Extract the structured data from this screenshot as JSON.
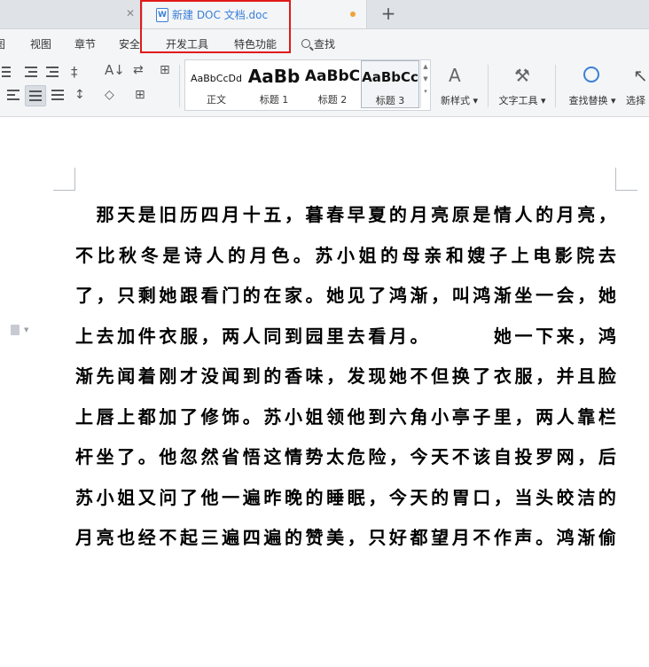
{
  "tabs": {
    "active_title": "新建 DOC 文档.doc",
    "new_tab_symbol": "+"
  },
  "menu": {
    "items": [
      "视图",
      "章节",
      "安全",
      "开发工具",
      "特色功能"
    ],
    "search_label": "查找"
  },
  "ribbon": {
    "styles": [
      {
        "preview": "AaBbCcDd",
        "label": "正文"
      },
      {
        "preview": "AaBb",
        "label": "标题 1"
      },
      {
        "preview": "AaBbC",
        "label": "标题 2"
      },
      {
        "preview": "AaBbCc",
        "label": "标题 3"
      }
    ],
    "new_style_label": "新样式",
    "text_tools_label": "文字工具",
    "find_replace_label": "查找替换",
    "select_label": "选择"
  },
  "document": {
    "lines": [
      "　那天是旧历四月十五，暮春早夏的月亮原是情人的月亮，",
      "不比秋冬是诗人的月色。苏小姐的母亲和嫂子上电影院去",
      "了，只剩她跟看门的在家。她见了鸿渐，叫鸿渐坐一会，她",
      "上去加件衣服，两人同到园里去看月。　　　她一下来，鸿",
      "渐先闻着刚才没闻到的香味，发现她不但换了衣服，并且脸",
      "上唇上都加了修饰。苏小姐领他到六角小亭子里，两人靠栏",
      "杆坐了。他忽然省悟这情势太危险，今天不该自投罗网，后",
      "苏小姐又问了他一遍昨晚的睡眠，今天的胃口，当头皎洁的",
      "月亮也经不起三遍四遍的赞美，只好都望月不作声。鸿渐偷"
    ]
  },
  "colors": {
    "highlight": "#e11a1a",
    "tab_text": "#3b7fd6",
    "modified_dot": "#f0a23a"
  }
}
